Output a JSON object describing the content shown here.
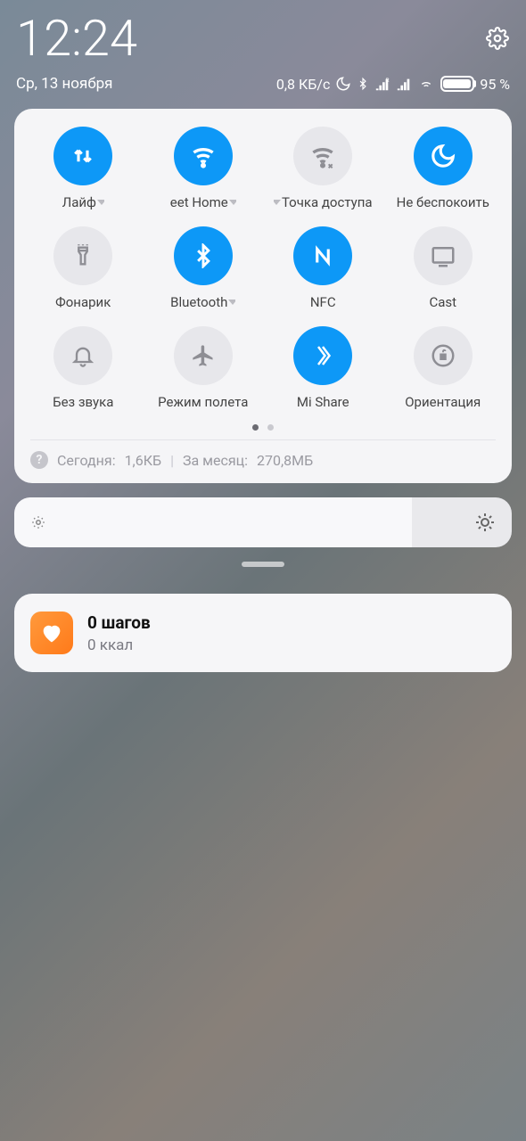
{
  "status": {
    "time": "12:24",
    "date": "Ср, 13 ноября",
    "data_rate": "0,8 КБ/с",
    "battery_percent": "95 %"
  },
  "toggles": [
    {
      "id": "mobile-data",
      "label": "Лайф",
      "on": true,
      "submenu": true
    },
    {
      "id": "wifi",
      "label": "eet Home",
      "on": true,
      "submenu": true,
      "prefix": "…"
    },
    {
      "id": "hotspot",
      "label": "Точка доступа",
      "on": false,
      "submenu": true
    },
    {
      "id": "dnd",
      "label": "Не беспокоить",
      "on": true
    },
    {
      "id": "flashlight",
      "label": "Фонарик",
      "on": false
    },
    {
      "id": "bluetooth",
      "label": "Bluetooth",
      "on": true,
      "submenu": true
    },
    {
      "id": "nfc",
      "label": "NFC",
      "on": true
    },
    {
      "id": "cast",
      "label": "Cast",
      "on": false
    },
    {
      "id": "mute",
      "label": "Без звука",
      "on": false
    },
    {
      "id": "airplane",
      "label": "Режим полета",
      "on": false
    },
    {
      "id": "mishare",
      "label": "Mi Share",
      "on": true
    },
    {
      "id": "orientation",
      "label": "Ориентация",
      "on": false
    }
  ],
  "usage": {
    "today_label": "Сегодня:",
    "today_value": "1,6КБ",
    "month_label": "За месяц:",
    "month_value": "270,8МБ"
  },
  "notification": {
    "title": "0 шагов",
    "subtitle": "0 ккал"
  }
}
